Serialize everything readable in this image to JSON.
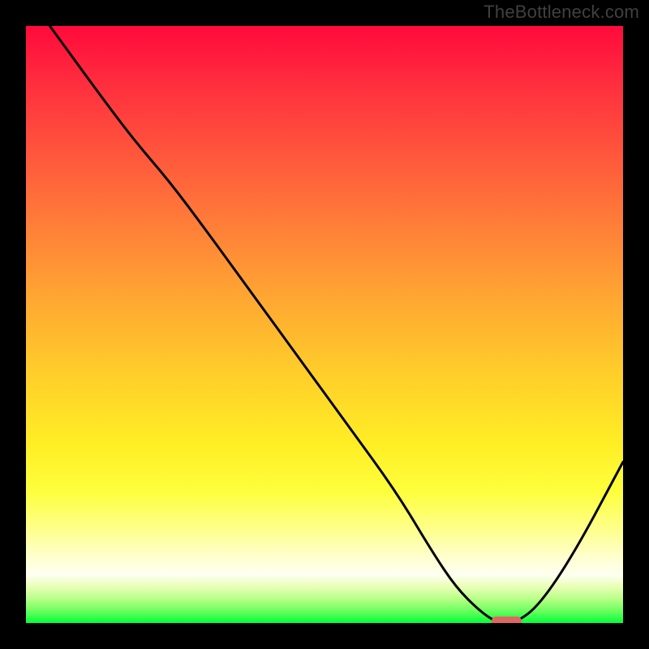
{
  "watermark": "TheBottleneck.com",
  "chart_data": {
    "type": "line",
    "title": "",
    "xlabel": "",
    "ylabel": "",
    "xlim": [
      0,
      100
    ],
    "ylim": [
      0,
      100
    ],
    "grid": false,
    "legend": false,
    "series": [
      {
        "name": "bottleneck-curve",
        "x": [
          4,
          12,
          18,
          24,
          30,
          38,
          46,
          54,
          62,
          68,
          72,
          76,
          79,
          82,
          86,
          92,
          100
        ],
        "y": [
          100,
          89,
          81,
          74,
          66,
          55,
          44,
          33,
          22,
          12,
          6,
          2,
          0,
          0,
          3,
          12,
          27
        ]
      }
    ],
    "marker": {
      "name": "optimal-range",
      "x_start": 78,
      "x_end": 83,
      "y": 0,
      "color": "#e06666"
    },
    "gradient_stops": [
      {
        "pos": 0,
        "color": "#ff0a3c"
      },
      {
        "pos": 10,
        "color": "#ff2f3e"
      },
      {
        "pos": 22,
        "color": "#ff583c"
      },
      {
        "pos": 34,
        "color": "#ff8038"
      },
      {
        "pos": 46,
        "color": "#ffa832"
      },
      {
        "pos": 58,
        "color": "#ffcd2a"
      },
      {
        "pos": 70,
        "color": "#ffee25"
      },
      {
        "pos": 78,
        "color": "#fdff3c"
      },
      {
        "pos": 85,
        "color": "#feff94"
      },
      {
        "pos": 89,
        "color": "#ffffcf"
      },
      {
        "pos": 92,
        "color": "#fefff0"
      },
      {
        "pos": 94,
        "color": "#e7ffb3"
      },
      {
        "pos": 96,
        "color": "#b6ff86"
      },
      {
        "pos": 98,
        "color": "#6aff5d"
      },
      {
        "pos": 100,
        "color": "#00ff3a"
      }
    ]
  }
}
